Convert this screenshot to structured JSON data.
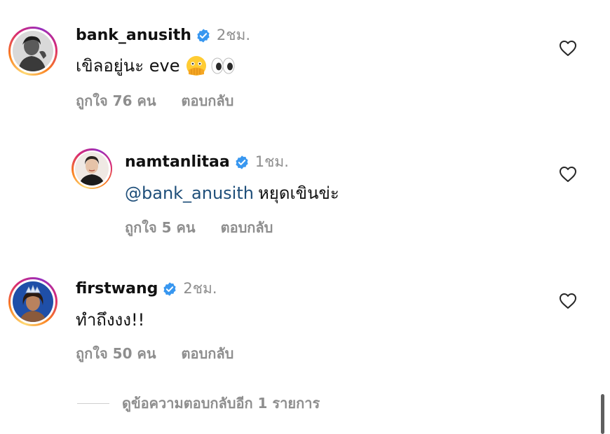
{
  "comments": [
    {
      "username": "bank_anusith",
      "time": "2ชม.",
      "text": "เขิลอยู่นะ eve",
      "emojis": [
        "face-with-open-eyes-and-hand-over-mouth-emoji",
        "eyes-emoji"
      ],
      "likes": "ถูกใจ 76 คน",
      "reply_label": "ตอบกลับ",
      "verified": true
    },
    {
      "username": "namtanlitaa",
      "time": "1ชม.",
      "mention": "@bank_anusith",
      "text": "หยุดเขินข่ะ",
      "likes": "ถูกใจ 5 คน",
      "reply_label": "ตอบกลับ",
      "verified": true
    },
    {
      "username": "firstwang",
      "time": "2ชม.",
      "text": "ทำถึงงง!!",
      "likes": "ถูกใจ 50 คน",
      "reply_label": "ตอบกลับ",
      "verified": true
    }
  ],
  "view_more_replies": "ดูข้อความตอบกลับอีก 1 รายการ",
  "colors": {
    "verified_badge": "#3897f0",
    "mention": "#1f4f7a",
    "secondary_text": "#8e8e8e"
  },
  "icons": [
    "verified-badge-icon",
    "heart-outline-icon"
  ]
}
